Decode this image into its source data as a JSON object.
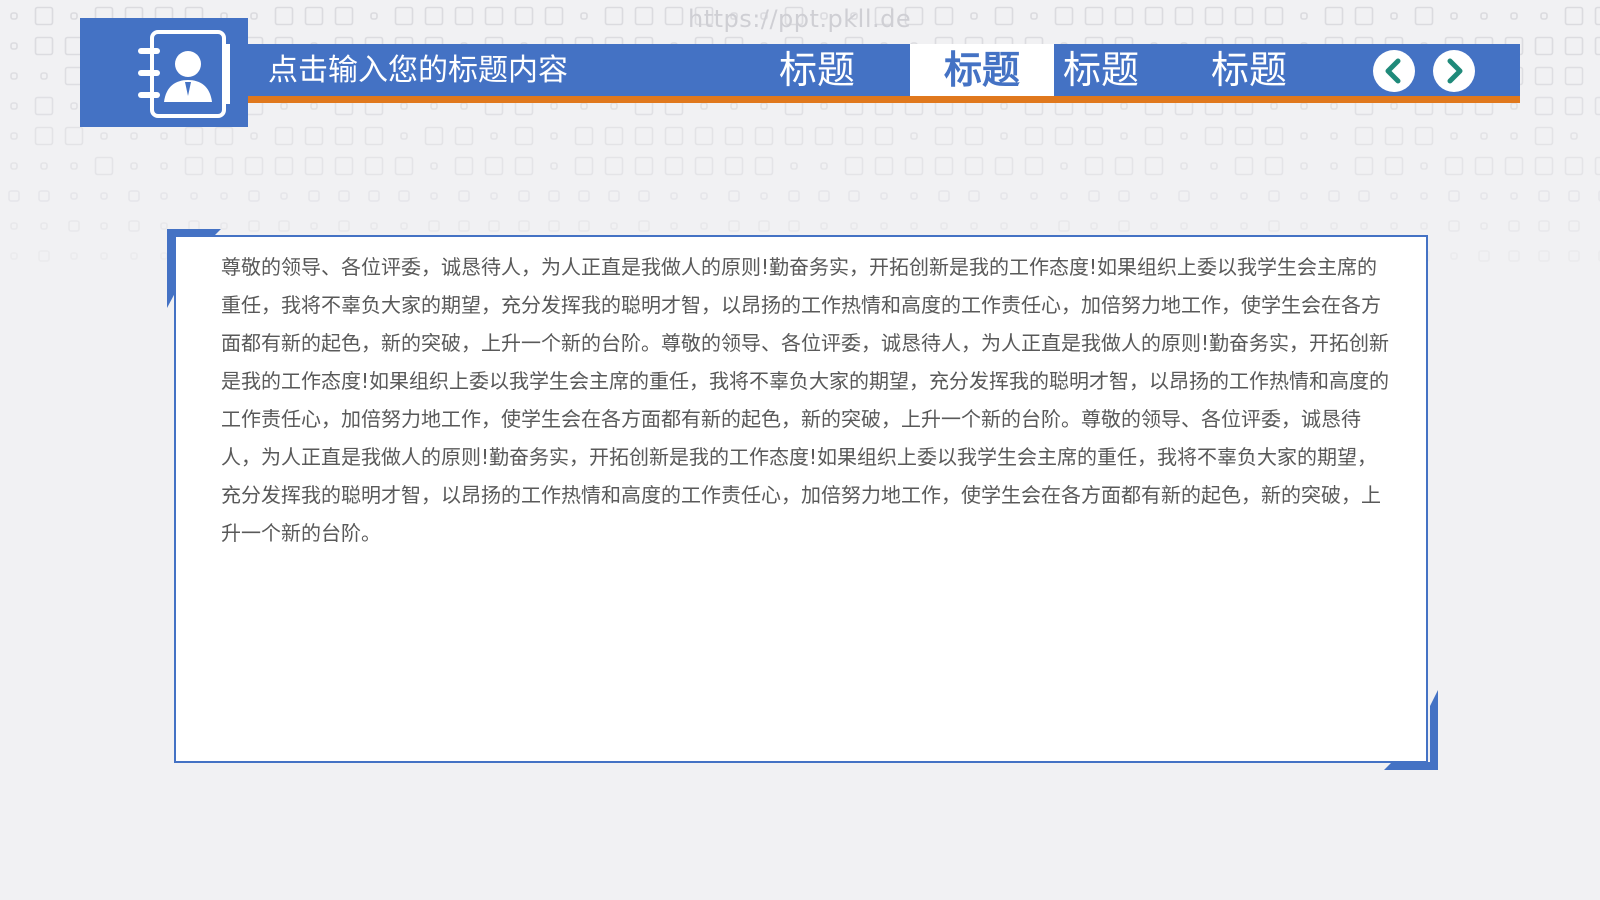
{
  "watermark": "https://ppt.pkll.de",
  "header": {
    "title": "点击输入您的标题内容",
    "tabs": [
      {
        "label": "标题",
        "active": false
      },
      {
        "label": "标题",
        "active": true
      },
      {
        "label": "标题",
        "active": false
      },
      {
        "label": "标题",
        "active": false
      }
    ],
    "prev_icon": "chevron-left-icon",
    "next_icon": "chevron-right-icon",
    "badge_icon": "contact-book-icon"
  },
  "content": {
    "paragraph": "尊敬的领导、各位评委，诚恳待人，为人正直是我做人的原则!勤奋务实，开拓创新是我的工作态度!如果组织上委以我学生会主席的重任，我将不辜负大家的期望，充分发挥我的聪明才智，以昂扬的工作热情和高度的工作责任心，加倍努力地工作，使学生会在各方面都有新的起色，新的突破，上升一个新的台阶。尊敬的领导、各位评委，诚恳待人，为人正直是我做人的原则!勤奋务实，开拓创新是我的工作态度!如果组织上委以我学生会主席的重任，我将不辜负大家的期望，充分发挥我的聪明才智，以昂扬的工作热情和高度的工作责任心，加倍努力地工作，使学生会在各方面都有新的起色，新的突破，上升一个新的台阶。尊敬的领导、各位评委，诚恳待人，为人正直是我做人的原则!勤奋务实，开拓创新是我的工作态度!如果组织上委以我学生会主席的重任，我将不辜负大家的期望，充分发挥我的聪明才智，以昂扬的工作热情和高度的工作责任心，加倍努力地工作，使学生会在各方面都有新的起色，新的突破，上升一个新的台阶。"
  },
  "colors": {
    "primary": "#4472c4",
    "accent": "#e0781d",
    "nav_chevron": "#1f8a7a",
    "text": "#595959"
  }
}
